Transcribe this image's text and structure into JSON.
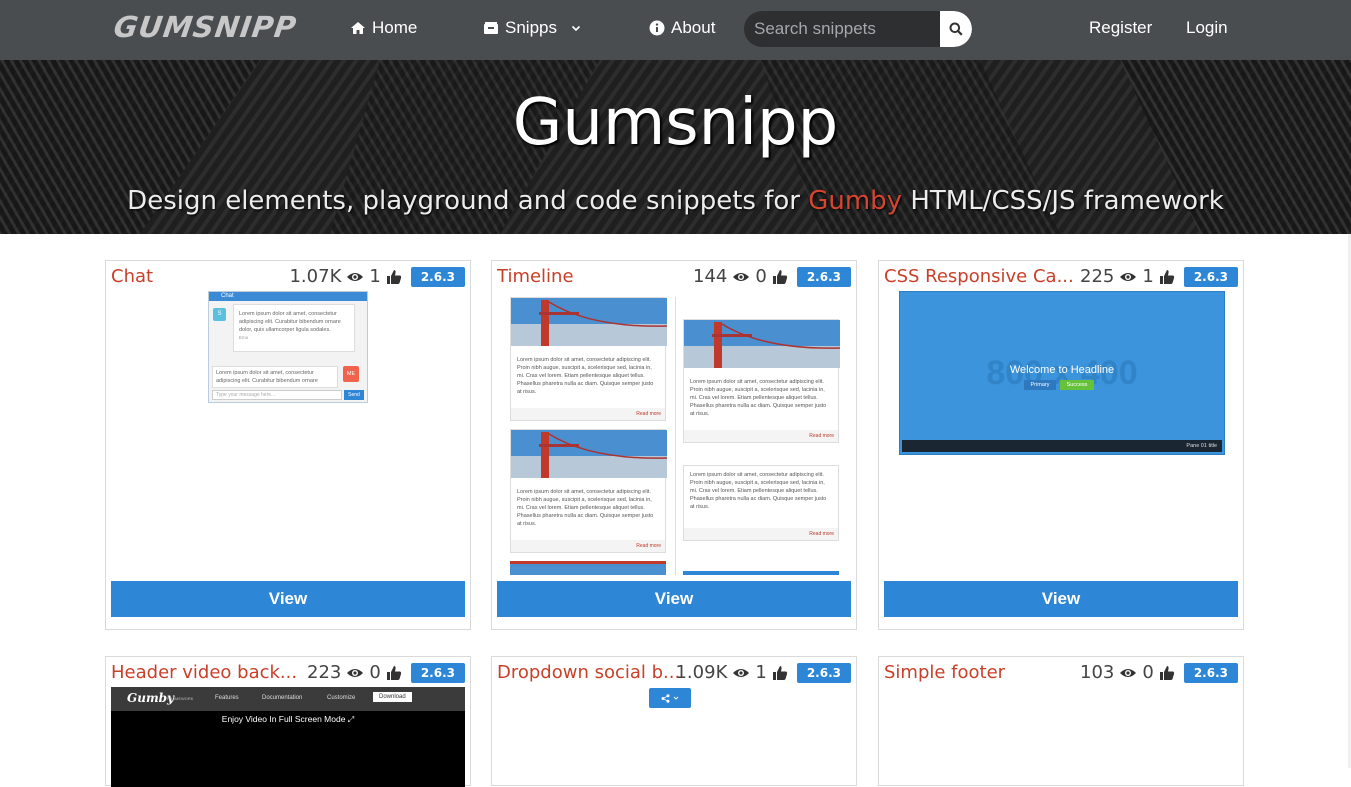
{
  "nav": {
    "logo": "GUMSNIPP",
    "home": "Home",
    "snipps": "Snipps",
    "about": "About",
    "search_placeholder": "Search snippets",
    "register": "Register",
    "login": "Login"
  },
  "hero": {
    "title": "Gumsnipp",
    "subtitle_before": "Design elements, playground and code snippets for ",
    "subtitle_highlight": "Gumby",
    "subtitle_after": " HTML/CSS/JS framework"
  },
  "colors": {
    "accent": "#2e86d6",
    "title_red": "#c9402a",
    "nav_bg": "#4a4d50"
  },
  "cards": [
    {
      "title": "Chat",
      "views": "1.07K",
      "likes": "1",
      "version": "2.6.3",
      "view_label": "View"
    },
    {
      "title": "Timeline",
      "views": "144",
      "likes": "0",
      "version": "2.6.3",
      "view_label": "View"
    },
    {
      "title": "CSS Responsive Ca...",
      "views": "225",
      "likes": "1",
      "version": "2.6.3",
      "view_label": "View"
    },
    {
      "title": "Header video back...",
      "views": "223",
      "likes": "0",
      "version": "2.6.3"
    },
    {
      "title": "Dropdown social b...",
      "views": "1.09K",
      "likes": "1",
      "version": "2.6.3"
    },
    {
      "title": "Simple footer",
      "views": "103",
      "likes": "0",
      "version": "2.6.3"
    }
  ],
  "previews": {
    "chat": {
      "header": "Chat",
      "msg1": "Lorem ipsum dolor sit amet, consectetur adipiscing elit. Curabitur bibendum ornare dolor, quis ullamcorper ligula sodales.",
      "msg1_meta": "Emo",
      "msg2": "Lorem ipsum dolor sit amet, consectetur adipiscing elit. Curabitur bibendum ornare",
      "me": "ME",
      "avatar": "S",
      "input_placeholder": "Type your message here...",
      "send": "Send"
    },
    "timeline": {
      "text": "Lorem ipsum dolor sit amet, consectetur adipiscing elit. Proin nibh augue, suscipit a, scelerisque sed, lacinia in, mi. Cras vel lorem. Etiam pellentesque aliquet tellus. Phasellus pharetra nulla ac diam. Quisque semper justo at risus.",
      "read_more": "Read more"
    },
    "carousel": {
      "bg_text": "800 x 400",
      "headline": "Welcome to Headline",
      "primary": "Primary",
      "success": "Success",
      "pane": "Pane 01 title"
    },
    "video": {
      "brand": "Gumby",
      "brand_sub": "FRAMEWORK",
      "links": [
        "Features",
        "Documentation",
        "Customize"
      ],
      "download": "Download",
      "caption": "Enjoy Video In Full Screen Mode"
    }
  }
}
